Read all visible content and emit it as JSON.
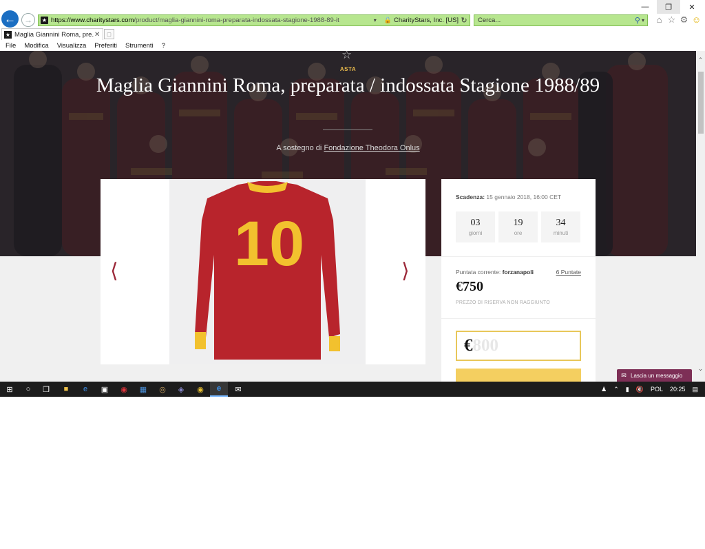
{
  "browser": {
    "url_domain": "https://www.charitystars.com",
    "url_path": "/product/maglia-giannini-roma-preparata-indossata-stagione-1988-89-it",
    "site_identity": "CharityStars, Inc. [US]",
    "search_placeholder": "Cerca...",
    "tab_title": "Maglia Giannini Roma, pre...",
    "menu": [
      "File",
      "Modifica",
      "Visualizza",
      "Preferiti",
      "Strumenti",
      "?"
    ]
  },
  "hero": {
    "badge": "ASTA",
    "title": "Maglia Giannini Roma, preparata / indossata Stagione 1988/89",
    "support_prefix": "A sostegno di",
    "support_link": "Fondazione Theodora Onlus"
  },
  "auction": {
    "deadline_label": "Scadenza:",
    "deadline_value": "15 gennaio 2018, 16:00 CET",
    "countdown": [
      {
        "value": "03",
        "label": "giorni"
      },
      {
        "value": "19",
        "label": "ore"
      },
      {
        "value": "34",
        "label": "minuti"
      }
    ],
    "current_bid_label": "Puntata corrente:",
    "current_bidder": "forzanapoli",
    "bids_count": "6 Puntate",
    "current_price": "€750",
    "reserve_note": "PREZZO DI RISERVA NON RAGGIUNTO",
    "bid_currency": "€",
    "bid_placeholder": "800"
  },
  "jersey": {
    "number": "10",
    "colors": {
      "body": "#b8242c",
      "accent": "#f2c12e"
    }
  },
  "message_tab": "Lascia un messaggio",
  "taskbar": {
    "language": "POL",
    "time": "20:25"
  },
  "colors": {
    "accent_gold": "#e6b84c",
    "button": "#f4cf60",
    "arrow": "#9c2a3a",
    "message": "#7d2f56"
  }
}
